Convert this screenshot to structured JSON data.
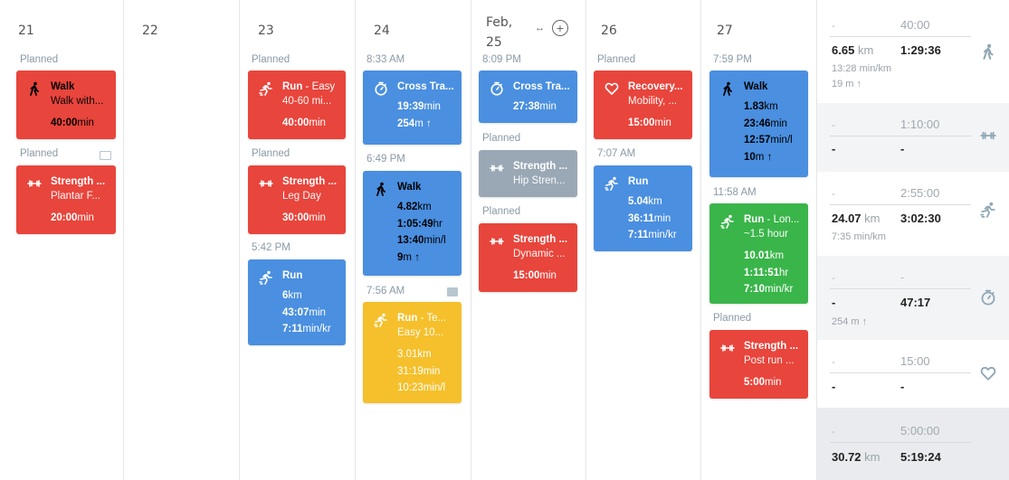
{
  "days": [
    {
      "date": "21"
    },
    {
      "date": "22"
    },
    {
      "date": "23"
    },
    {
      "date": "24"
    },
    {
      "date_line1": "Feb,",
      "date_line2": "25"
    },
    {
      "date": "26"
    },
    {
      "date": "27"
    }
  ],
  "icons": {
    "move": "arrows-horizontal-icon",
    "add": "plus-circle-icon"
  },
  "labels": {
    "planned": "Planned"
  },
  "cards": {
    "d21_walk": {
      "title": "Walk",
      "sub": "Walk with...",
      "stat1": "40:00",
      "stat1_unit": "min"
    },
    "d21_strength": {
      "title": "Strength ...",
      "sub": "Plantar F...",
      "stat1": "20:00",
      "stat1_unit": "min"
    },
    "d23_run_easy": {
      "title": "Run",
      "title_rest": " - Easy",
      "sub": "40-60 mi...",
      "stat1": "40:00",
      "stat1_unit": "min"
    },
    "d23_strength": {
      "title": "Strength ...",
      "sub": "Leg Day",
      "stat1": "30:00",
      "stat1_unit": "min"
    },
    "d23_time": "5:42 PM",
    "d23_run": {
      "title": "Run",
      "stat1": "6",
      "stat1_unit": "km",
      "stat2": "43:07",
      "stat2_unit": "min",
      "stat3": "7:11",
      "stat3_unit": "min/kr"
    },
    "d24_time1": "8:33 AM",
    "d24_cross": {
      "title": "Cross Tra...",
      "stat1": "19:39",
      "stat1_unit": "min",
      "stat2": "254",
      "stat2_unit": "m",
      "stat2_arrow": "↑"
    },
    "d24_time2": "6:49 PM",
    "d24_walk": {
      "title": "Walk",
      "stat1": "4.82",
      "stat1_unit": "km",
      "stat2": "1:05:49",
      "stat2_unit": "hr",
      "stat3": "13:40",
      "stat3_unit": "min/l",
      "stat4": "9",
      "stat4_unit": "m",
      "stat4_arrow": "↑"
    },
    "d24_time3": "7:56 AM",
    "d24_run_tempo": {
      "title": "Run",
      "title_rest": " - Te...",
      "sub": "Easy 10...",
      "stat1": "3.01",
      "stat1_unit": "km",
      "stat2": "31:19",
      "stat2_unit": "min",
      "stat3": "10:23",
      "stat3_unit": "min/l"
    },
    "d25_time1": "8:09 PM",
    "d25_cross": {
      "title": "Cross Tra...",
      "stat1": "27:38",
      "stat1_unit": "min"
    },
    "d25_strength_gray": {
      "title": "Strength ...",
      "sub": "Hip Stren..."
    },
    "d25_strength": {
      "title": "Strength ...",
      "sub": "Dynamic ...",
      "stat1": "15:00",
      "stat1_unit": "min"
    },
    "d26_recovery": {
      "title": "Recovery...",
      "sub": "Mobility, ...",
      "stat1": "15:00",
      "stat1_unit": "min"
    },
    "d26_time": "7:07 AM",
    "d26_run": {
      "title": "Run",
      "stat1": "5.04",
      "stat1_unit": "km",
      "stat2": "36:11",
      "stat2_unit": "min",
      "stat3": "7:11",
      "stat3_unit": "min/kr"
    },
    "d27_time1": "7:59 PM",
    "d27_walk": {
      "title": "Walk",
      "stat1": "1.83",
      "stat1_unit": "km",
      "stat2": "23:46",
      "stat2_unit": "min",
      "stat3": "12:57",
      "stat3_unit": "min/l",
      "stat4": "10",
      "stat4_unit": "m",
      "stat4_arrow": "↑"
    },
    "d27_time2": "11:58 AM",
    "d27_run_long": {
      "title": "Run",
      "title_rest": " - Lon...",
      "sub": "~1.5 hour",
      "stat1": "10.01",
      "stat1_unit": "km",
      "stat2": "1:11:51",
      "stat2_unit": "hr",
      "stat3": "7:10",
      "stat3_unit": "min/kr"
    },
    "d27_strength": {
      "title": "Strength ...",
      "sub": "Post run ...",
      "stat1": "5:00",
      "stat1_unit": "min"
    }
  },
  "summary": [
    {
      "icon": "walk-icon",
      "dash": "-",
      "goal": "40:00",
      "dist": "6.65",
      "dist_unit": "km",
      "time": "1:29:36",
      "pace": "13:28 min/km",
      "elev": "19 m",
      "elev_arrow": "↑"
    },
    {
      "icon": "dumbbell-icon",
      "dash": "-",
      "goal": "1:10:00",
      "dist": "-",
      "time": "-"
    },
    {
      "icon": "run-icon",
      "dash": "-",
      "goal": "2:55:00",
      "dist": "24.07",
      "dist_unit": "km",
      "time": "3:02:30",
      "pace": "7:35 min/km"
    },
    {
      "icon": "stopwatch-icon",
      "dash": "-",
      "goal": "-",
      "dist": "-",
      "time": "47:17",
      "elev": "254 m",
      "elev_arrow": "↑"
    },
    {
      "icon": "heart-icon",
      "dash": "-",
      "goal": "15:00",
      "dist": "-",
      "time": "-"
    },
    {
      "dash": "-",
      "goal": "5:00:00",
      "dist": "30.72",
      "dist_unit": "km",
      "time": "5:19:24"
    }
  ],
  "colors": {
    "red": "#e8453c",
    "blue": "#4a8fe0",
    "green": "#3ab54a",
    "yellow": "#f5c02c",
    "gray": "#9aa8b5"
  }
}
